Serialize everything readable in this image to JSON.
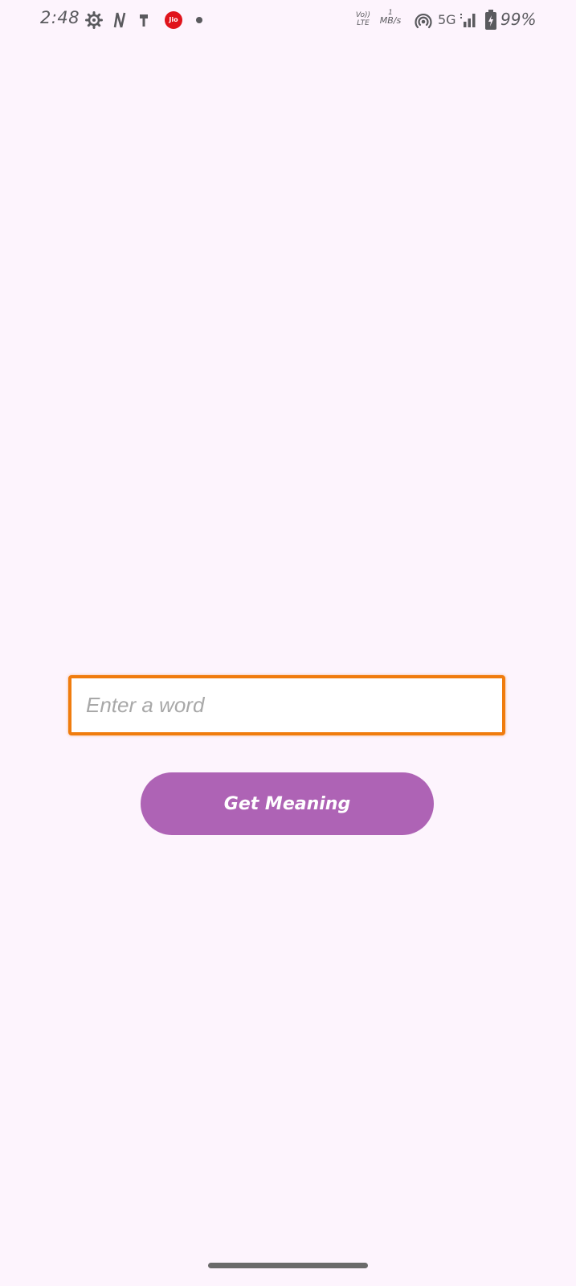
{
  "status_bar": {
    "time": "2:48",
    "carrier_badge": "Jio",
    "volte_top": "Vo))",
    "volte_bottom": "LTE",
    "speed_value": "1",
    "speed_unit": "MB/s",
    "network_type": "5G",
    "battery_percent": "99%",
    "icons": [
      "settings-gear-icon",
      "netflix-n-icon",
      "usb-icon",
      "jio-icon",
      "notification-dot-icon",
      "hotspot-icon",
      "signal-icon",
      "battery-charging-icon"
    ]
  },
  "search": {
    "placeholder": "Enter a word",
    "value": ""
  },
  "actions": {
    "get_meaning_label": "Get Meaning"
  },
  "colors": {
    "background": "#fdf4fd",
    "accent_border": "#f07c0e",
    "button": "#ae63b5",
    "button_text": "#ffffff"
  }
}
